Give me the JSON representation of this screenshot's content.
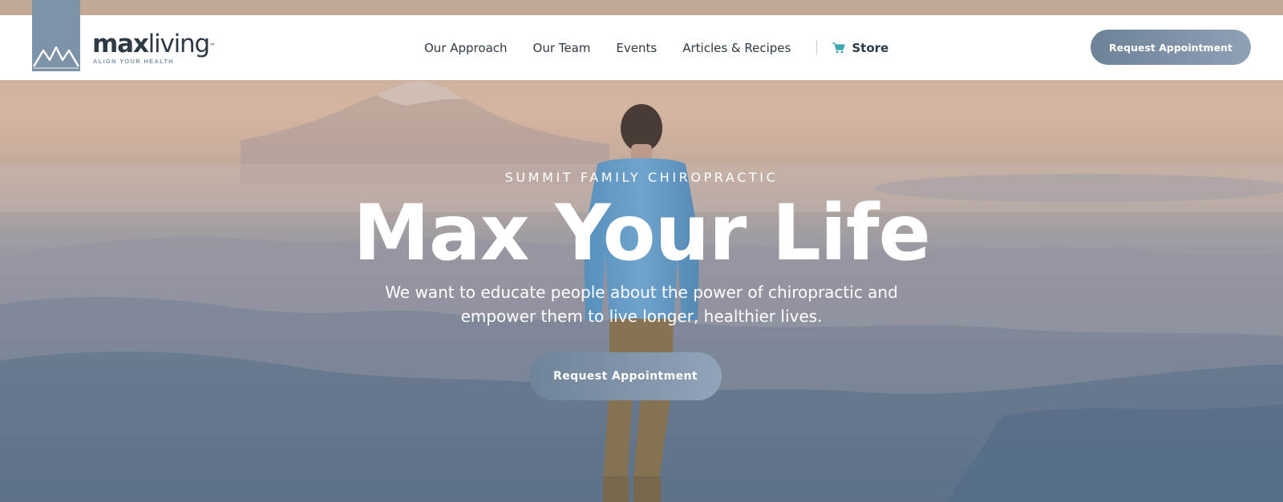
{
  "brand": {
    "name_bold": "max",
    "name_light": "living",
    "trademark": "™",
    "tagline": "ALIGN YOUR HEALTH",
    "logo_icon": "mountain-peaks-icon"
  },
  "nav": {
    "items": [
      {
        "label": "Our Approach"
      },
      {
        "label": "Our Team"
      },
      {
        "label": "Events"
      },
      {
        "label": "Articles & Recipes"
      }
    ],
    "store": {
      "label": "Store",
      "icon": "shopping-cart-icon"
    }
  },
  "header_cta": {
    "label": "Request Appointment"
  },
  "hero": {
    "eyebrow": "SUMMIT FAMILY CHIROPRACTIC",
    "headline": "Max Your Life",
    "subtext": "We want to educate people about the power of chiropractic and empower them to live longer, healthier lives.",
    "cta_label": "Request Appointment"
  },
  "colors": {
    "brand_slate": "#7d93a8",
    "text_dark": "#2e3a46",
    "cart_teal": "#3aa8b0",
    "white": "#ffffff"
  }
}
